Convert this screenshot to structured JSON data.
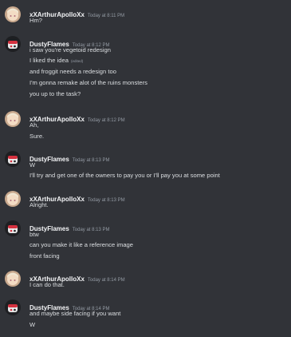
{
  "users": {
    "arthur": "xXArthurApolloXx",
    "dusty": "DustyFlames"
  },
  "messages": [
    {
      "author": "xXArthurApolloXx",
      "time": "Today at 8:11 PM",
      "lines": [
        "Hm?"
      ]
    },
    {
      "author": "DustyFlames",
      "time": "Today at 8:12 PM",
      "lines": [
        "i saw you're vegetoid redesign",
        "I liked the idea",
        "and froggit needs a redesign too",
        "I'm gonna remake alot of the ruins monsters",
        "you up to the task?"
      ],
      "edited_label": "(edited)"
    },
    {
      "author": "xXArthurApolloXx",
      "time": "Today at 8:12 PM",
      "lines": [
        "Ah,",
        "Sure."
      ]
    },
    {
      "author": "DustyFlames",
      "time": "Today at 8:13 PM",
      "lines": [
        "W",
        "I'll try and get one of the owners to pay you or I'll pay you at some point"
      ]
    },
    {
      "author": "xXArthurApolloXx",
      "time": "Today at 8:13 PM",
      "lines": [
        "Alright."
      ]
    },
    {
      "author": "DustyFlames",
      "time": "Today at 8:13 PM",
      "lines": [
        "btw",
        "can you make it like a reference image",
        "front facing"
      ]
    },
    {
      "author": "xXArthurApolloXx",
      "time": "Today at 8:14 PM",
      "lines": [
        "I can do that."
      ]
    },
    {
      "author": "DustyFlames",
      "time": "Today at 8:14 PM",
      "lines": [
        "and maybe side facing if you want",
        "W"
      ]
    }
  ],
  "colors": {
    "background": "#313338",
    "username": "#f2f3f5",
    "timestamp": "#949ba4",
    "message_text": "#dbdee1"
  }
}
